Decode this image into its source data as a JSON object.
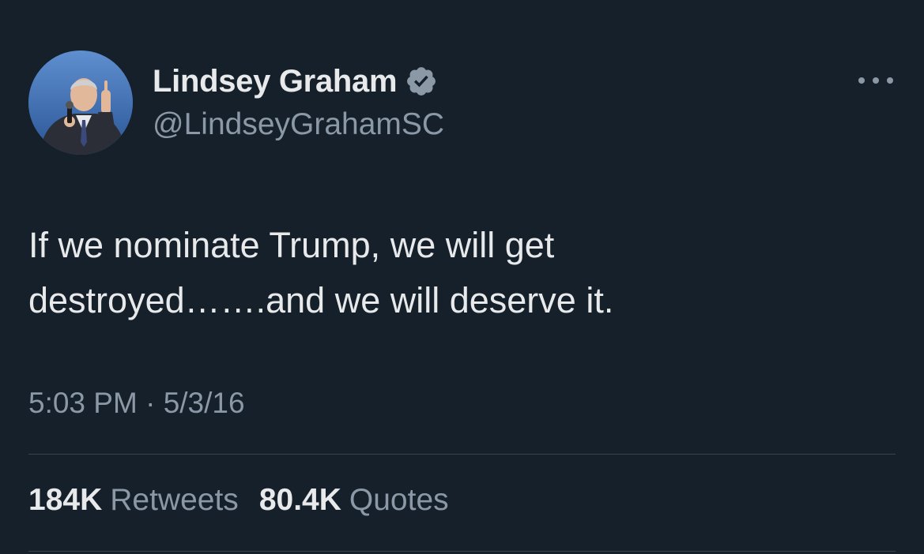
{
  "author": {
    "display_name": "Lindsey Graham",
    "handle": "@LindseyGrahamSC",
    "verified": true,
    "verified_color": "#8b98a5"
  },
  "tweet": {
    "text_line1": "If we nominate Trump, we will get",
    "text_line2": "destroyed…….and we will deserve it.",
    "time": "5:03 PM",
    "separator": "·",
    "date": "5/3/16"
  },
  "stats": {
    "retweets_count": "184K",
    "retweets_label": "Retweets",
    "quotes_count": "80.4K",
    "quotes_label": "Quotes"
  },
  "icons": {
    "more": "more-horizontal-icon",
    "verified": "verified-badge-icon"
  },
  "colors": {
    "background": "#15202b",
    "primary_text": "#e7e9ea",
    "secondary_text": "#8b98a5",
    "divider": "#38444d"
  }
}
